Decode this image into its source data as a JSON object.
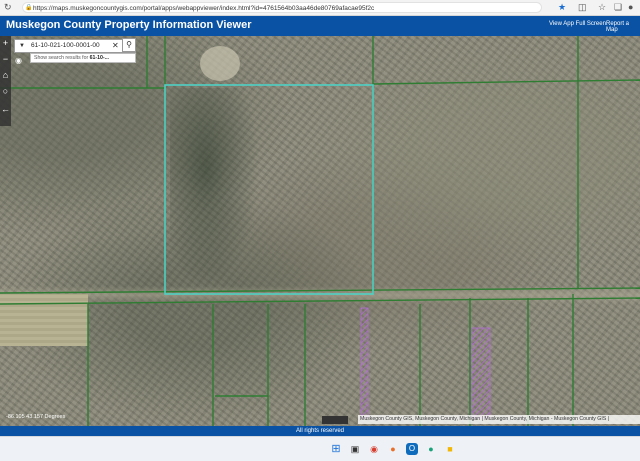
{
  "browser": {
    "url": "https://maps.muskegoncountygis.com/portal/apps/webappviewer/index.html?id=4761564b03aa46de80769afacae95f2c"
  },
  "header": {
    "title": "Muskegon County Property Information Viewer",
    "links": [
      "View App Full Screen",
      "Report a Map"
    ]
  },
  "search": {
    "value": "61-10-021-100-0001-00",
    "suggestion_prefix": "Show search results for ",
    "suggestion_term": "61-10-..."
  },
  "map": {
    "coordinate_readout": "-86.105 43.157 Degrees",
    "scale_text": "",
    "attribution": "Muskegon County GIS, Muskegon County, Michigan | Muskegon County, Michigan - Muskegon County GIS |",
    "parcel_line_color": "#2e7d32",
    "selected_parcel_color": "#4fd1c5",
    "hatch_color": "#b36bd6"
  },
  "footer": {
    "text": "All rights reserved"
  },
  "colors": {
    "header_bg": "#0a52a4"
  }
}
